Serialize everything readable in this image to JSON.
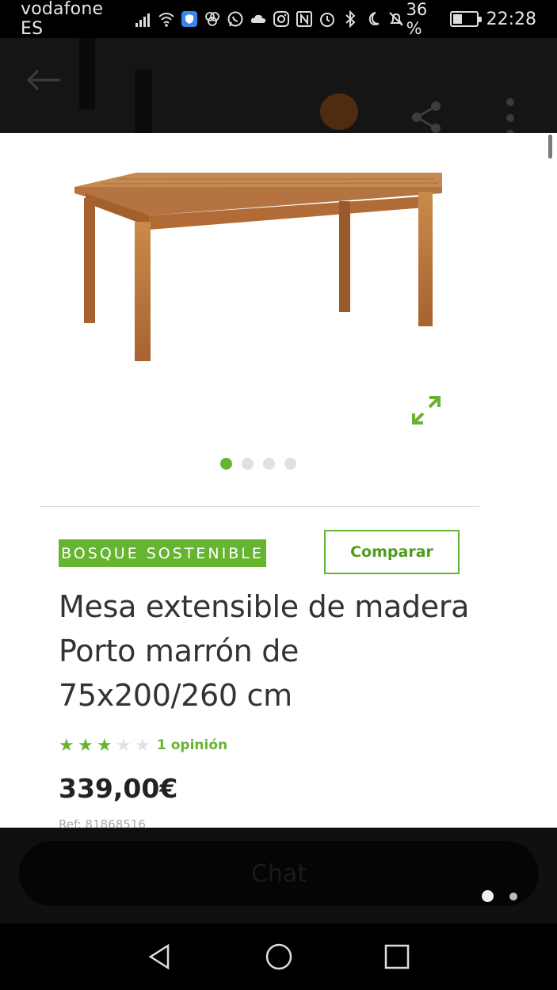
{
  "status_bar": {
    "carrier": "vodafone ES",
    "battery_percent": "36 %",
    "battery_level": 0.36,
    "time": "22:28",
    "icons": [
      "signal-icon",
      "wifi-icon",
      "shield-app-icon",
      "clover-icon",
      "whatsapp-icon",
      "cloud-icon",
      "instagram-icon",
      "nfc-icon",
      "alarm-icon",
      "bluetooth-icon",
      "moon-icon",
      "mute-icon"
    ]
  },
  "app_bar": {
    "icons": [
      "back-arrow-icon",
      "cart-icon",
      "share-icon",
      "more-vert-icon"
    ]
  },
  "product": {
    "image_name": "product-image-wooden-table",
    "badge": "BOSQUE SOSTENIBLE",
    "compare_label": "Comparar",
    "title": "Mesa extensible de madera Porto marrón de 75x200/260 cm",
    "rating": 3,
    "rating_max": 5,
    "reviews": "1 opinión",
    "price": "339,00€",
    "ref": "Ref: 81868516"
  },
  "carousel": {
    "count": 4,
    "active_index": 0
  },
  "bottom": {
    "chat_label": "Chat",
    "pages": 2,
    "active_page": 0
  },
  "colors": {
    "accent_green": "#66b531",
    "title_text": "#333333",
    "price_text": "#222222"
  }
}
